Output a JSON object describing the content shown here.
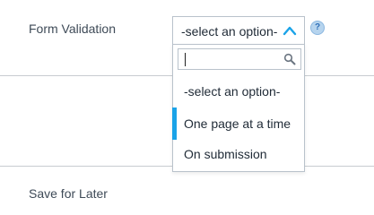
{
  "form": {
    "validation_label": "Form Validation",
    "save_label": "Save for Later"
  },
  "select": {
    "selected_value": "-select an option-",
    "chevron_icon": "chevron-up-icon",
    "help_icon": "help-icon",
    "help_glyph": "?"
  },
  "dropdown": {
    "search_value": "",
    "search_placeholder": "",
    "search_icon": "magnifier-icon",
    "options": [
      {
        "label": "-select an option-"
      },
      {
        "label": "One page at a time"
      },
      {
        "label": "On submission"
      }
    ],
    "highlighted_index": 1
  },
  "colors": {
    "accent": "#1aa3e8",
    "label_text": "#3e4a57",
    "border": "#b9c2cb",
    "help_bg": "#b6d4ee"
  }
}
